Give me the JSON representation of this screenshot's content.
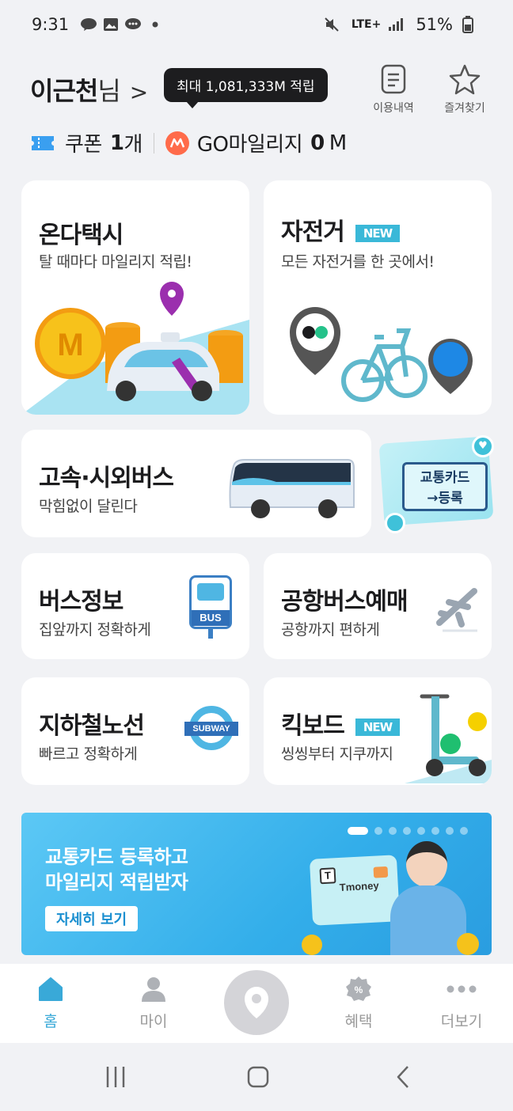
{
  "status_bar": {
    "time": "9:31",
    "network": "LTE+",
    "battery": "51%"
  },
  "header": {
    "user_name": "이근천",
    "name_suffix": "님",
    "chevron": ">",
    "tooltip": "최대 1,081,333M 적립",
    "history_label": "이용내역",
    "favorites_label": "즐겨찾기",
    "coupon_label": "쿠폰",
    "coupon_count": "1",
    "coupon_unit": "개",
    "mileage_label": "GO마일리지",
    "mileage_value": "0",
    "mileage_unit": "M"
  },
  "cards": {
    "taxi": {
      "title": "온다택시",
      "sub": "탈 때마다 마일리지 적립!"
    },
    "bike": {
      "title": "자전거",
      "badge": "NEW",
      "sub": "모든 자전거를 한 곳에서!"
    },
    "express_bus": {
      "title": "고속·시외버스",
      "sub": "막힘없이 달린다"
    },
    "card_register": {
      "line1": "교통카드",
      "line2": "→등록"
    },
    "bus_info": {
      "title": "버스정보",
      "sub": "집앞까지 정확하게",
      "sign": "BUS"
    },
    "airport_bus": {
      "title": "공항버스예매",
      "sub": "공항까지 편하게"
    },
    "subway": {
      "title": "지하철노선",
      "sub": "빠르고 정확하게",
      "sign": "SUBWAY"
    },
    "kickboard": {
      "title": "킥보드",
      "badge": "NEW",
      "sub": "씽씽부터 지쿠까지"
    }
  },
  "banner": {
    "line1": "교통카드 등록하고",
    "line2": "마일리지 적립받자",
    "detail": "자세히 보기",
    "card_brand": "Tmoney",
    "slide_count": 8,
    "active_slide": 1
  },
  "bottom_nav": {
    "home": "홈",
    "my": "마이",
    "benefits": "혜택",
    "more": "더보기"
  },
  "colors": {
    "accent": "#39a9d8",
    "badge": "#3ab8d8",
    "mileage": "#ff6b4a",
    "background": "#f1f2f5"
  }
}
